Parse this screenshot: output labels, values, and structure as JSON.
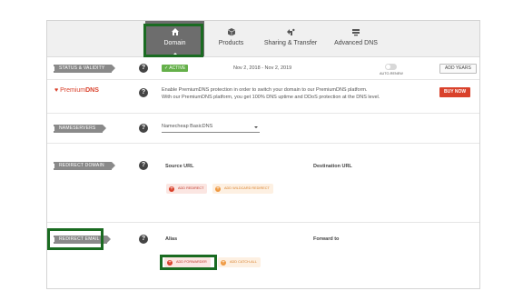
{
  "tabs": [
    {
      "label": "Domain",
      "icon": "home-icon"
    },
    {
      "label": "Products",
      "icon": "box-icon"
    },
    {
      "label": "Sharing & Transfer",
      "icon": "share-icon"
    },
    {
      "label": "Advanced DNS",
      "icon": "dns-icon"
    }
  ],
  "status": {
    "label": "STATUS & VALIDITY",
    "badge": "✓ ACTIVE",
    "dates": "Nov 2, 2018 - Nov 2, 2019",
    "auto_renew": "AUTO-RENEW",
    "add_years": "ADD YEARS"
  },
  "premium_dns": {
    "logo_prefix": "Premium",
    "logo_suffix": "DNS",
    "line1": "Enable PremiumDNS protection in order to switch your domain to our PremiumDNS platform.",
    "line2": "With our PremiumDNS platform, you get 100% DNS uptime and DDoS protection at the DNS level.",
    "buy_now": "BUY NOW"
  },
  "nameservers": {
    "label": "NAMESERVERS",
    "value": "Namecheap BasicDNS"
  },
  "redirect_domain": {
    "label": "REDIRECT DOMAIN",
    "source_col": "Source URL",
    "dest_col": "Destination URL",
    "add_redirect": "ADD REDIRECT",
    "add_wildcard": "ADD WILDCARD REDIRECT"
  },
  "redirect_email": {
    "label": "REDIRECT EMAIL",
    "alias_col": "Alias",
    "forward_col": "Forward to",
    "add_forwarder": "ADD FORWARDER",
    "add_catchall": "ADD CATCH-ALL"
  },
  "help_glyph": "?",
  "colors": {
    "accent_red": "#d9412b",
    "active_green": "#65b04a",
    "highlight_green": "#1a6b21",
    "tab_active": "#6d6d6d"
  }
}
